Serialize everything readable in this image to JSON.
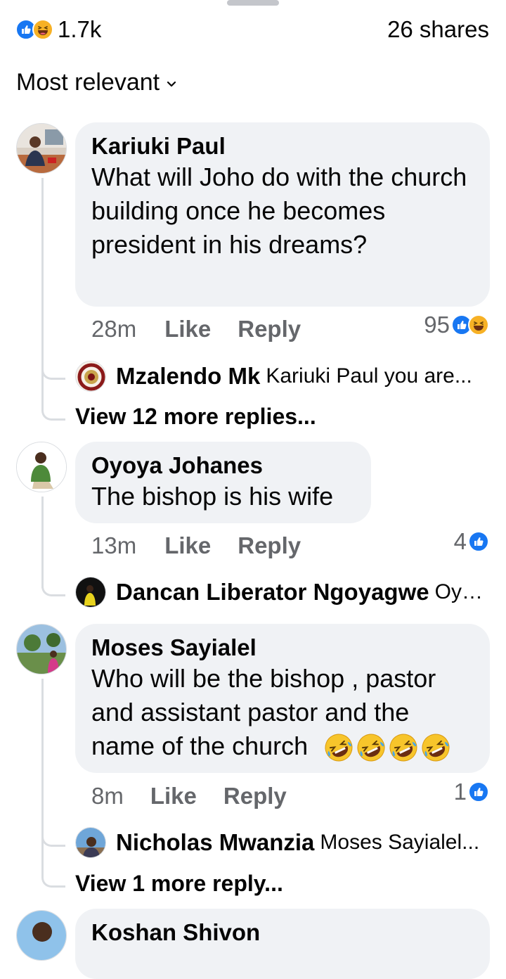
{
  "header": {
    "reaction_count": "1.7k",
    "shares": "26 shares",
    "reaction_icons": [
      "like-icon",
      "haha-icon"
    ]
  },
  "sort": {
    "label": "Most relevant"
  },
  "comments": [
    {
      "author": "Kariuki Paul",
      "text": "What will Joho do with the church building once he becomes president in his dreams?",
      "time": "28m",
      "like_label": "Like",
      "reply_label": "Reply",
      "reaction_count": "95",
      "reaction_icons": [
        "like-icon",
        "haha-icon"
      ],
      "reply_preview": {
        "author": "Mzalendo Mk",
        "snippet": "Kariuki Paul you are..."
      },
      "view_more": "View 12 more replies..."
    },
    {
      "author": "Oyoya Johanes",
      "text": "The bishop is his wife",
      "time": "13m",
      "like_label": "Like",
      "reply_label": "Reply",
      "reaction_count": "4",
      "reaction_icons": [
        "like-icon"
      ],
      "reply_preview": {
        "author": "Dancan Liberator Ngoyagwe",
        "snippet": "Oyo..."
      }
    },
    {
      "author": "Moses Sayialel",
      "text_lines": [
        "Who will be the bishop , pastor",
        "and assistant pastor and the",
        "name of the church"
      ],
      "emoji": [
        "rofl-emoji",
        "rofl-emoji",
        "rofl-emoji",
        "rofl-emoji"
      ],
      "time": "8m",
      "like_label": "Like",
      "reply_label": "Reply",
      "reaction_count": "1",
      "reaction_icons": [
        "like-icon"
      ],
      "reply_preview": {
        "author": "Nicholas Mwanzia",
        "snippet": "Moses Sayialel..."
      },
      "view_more": "View 1 more reply..."
    },
    {
      "author": "Koshan Shivon"
    }
  ],
  "colors": {
    "like_blue": "#1877f2",
    "haha_yellow": "#f7b125",
    "bubble_bg": "#f0f2f5",
    "meta_gray": "#65676b",
    "thread_line": "#dadde1"
  }
}
